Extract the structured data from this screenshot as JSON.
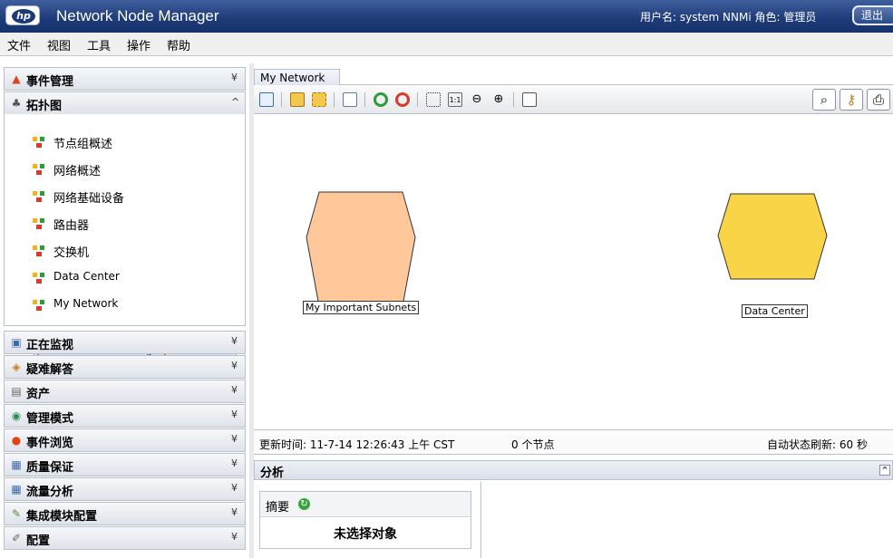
{
  "titlebar": {
    "logo_text": "hp",
    "app_title": "Network Node Manager",
    "user_info": "用户名: system  NNMi 角色: 管理员",
    "logout_label": "退出"
  },
  "menu": {
    "items": [
      "文件",
      "视图",
      "工具",
      "操作",
      "帮助"
    ]
  },
  "left_panel": {
    "sections": [
      {
        "label": "事件管理",
        "icon": "flame-icon",
        "expanded": false
      },
      {
        "label": "拓扑图",
        "icon": "topology-icon",
        "expanded": true
      },
      {
        "label": "正在监视",
        "icon": "monitor-icon",
        "expanded": false
      },
      {
        "label": "疑难解答",
        "icon": "troubleshoot-icon",
        "expanded": false
      },
      {
        "label": "资产",
        "icon": "inventory-icon",
        "expanded": false
      },
      {
        "label": "管理模式",
        "icon": "management-mode-icon",
        "expanded": false
      },
      {
        "label": "事件浏览",
        "icon": "incident-browse-icon",
        "expanded": false
      },
      {
        "label": "质量保证",
        "icon": "quality-icon",
        "expanded": false
      },
      {
        "label": "流量分析",
        "icon": "traffic-icon",
        "expanded": false
      },
      {
        "label": "集成模块配置",
        "icon": "integration-icon",
        "expanded": false
      },
      {
        "label": "配置",
        "icon": "config-icon",
        "expanded": false
      }
    ],
    "topology_items": [
      "节点组概述",
      "网络概述",
      "网络基础设备",
      "路由器",
      "交换机",
      "Data Center",
      "My Network"
    ],
    "selected_item": "My Network"
  },
  "main": {
    "tab_label": "My Network",
    "toolbar_icons": [
      "open-icon",
      "save-icon",
      "save-layout-icon",
      "copy-icon",
      "refresh-icon",
      "reset-icon",
      "fit-icon",
      "actual-size-icon",
      "zoom-out-icon",
      "zoom-in-icon",
      "overview-icon",
      "find-icon",
      "key-icon",
      "print-icon"
    ],
    "actual_size_label": "1:1",
    "nodes": [
      {
        "label": "My Important Subnets",
        "color": "#fec89a"
      },
      {
        "label": "Data Center",
        "color": "#f9d447"
      }
    ],
    "status": {
      "updated": "更新时间: 11-7-14 12:26:43 上午 CST",
      "node_count": "0 个节点",
      "auto_refresh": "自动状态刷新: 60 秒"
    }
  },
  "analysis": {
    "title": "分析",
    "summary_label": "摘要",
    "no_selection": "未选择对象"
  },
  "colors": {
    "titlebar": "#1d3a78",
    "selection_highlight": "#e8622a",
    "selected_row": "#cfe3fb"
  }
}
